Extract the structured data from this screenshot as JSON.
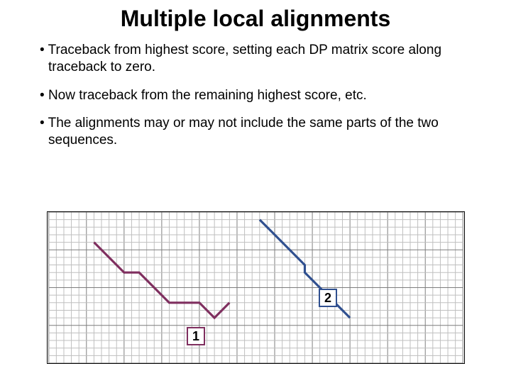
{
  "title": "Multiple local alignments",
  "bullets": [
    "Traceback from highest score, setting each DP matrix score along traceback to zero.",
    "Now traceback from the remaining highest score, etc.",
    "The alignments may or may not include the same parts of the two sequences."
  ],
  "labels": {
    "one": "1",
    "two": "2"
  },
  "chart_data": {
    "type": "line",
    "title": "",
    "xlabel": "",
    "ylabel": "",
    "grid": {
      "major": 5,
      "cols": 55,
      "rows": 20
    },
    "series": [
      {
        "name": "alignment-1",
        "label": "1",
        "color": "#7f2f5f",
        "points": [
          [
            6,
            4
          ],
          [
            10,
            8
          ],
          [
            12,
            8
          ],
          [
            16,
            12
          ],
          [
            20,
            12
          ],
          [
            22,
            14
          ],
          [
            24,
            12
          ]
        ]
      },
      {
        "name": "alignment-2",
        "label": "2",
        "color": "#2f4f8f",
        "points": [
          [
            28,
            1
          ],
          [
            34,
            7
          ],
          [
            34,
            8
          ],
          [
            40,
            14
          ]
        ]
      }
    ]
  }
}
